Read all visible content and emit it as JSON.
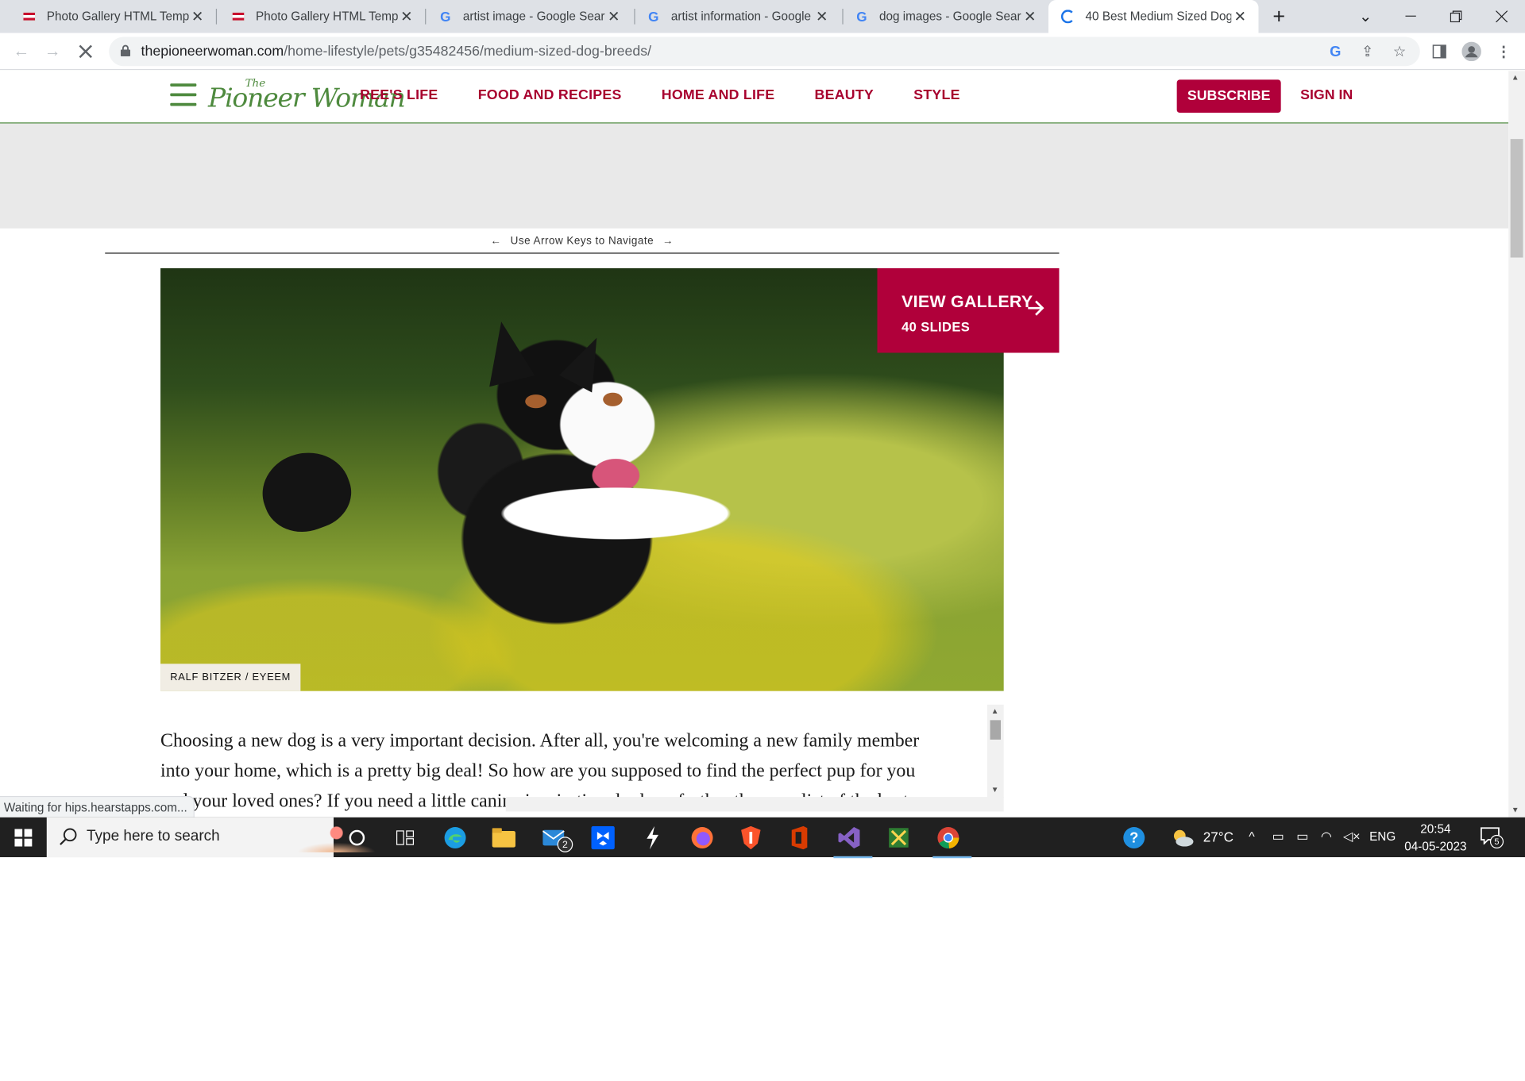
{
  "browser": {
    "tabs": [
      {
        "title": "Photo Gallery HTML Templa",
        "icon": "flag-favicon-icon"
      },
      {
        "title": "Photo Gallery HTML Templa",
        "icon": "flag-favicon-icon"
      },
      {
        "title": "artist image - Google Searc",
        "icon": "google-favicon-icon"
      },
      {
        "title": "artist information - Google",
        "icon": "google-favicon-icon"
      },
      {
        "title": "dog images - Google Searc",
        "icon": "google-favicon-icon"
      },
      {
        "title": "40 Best Medium Sized Dog",
        "icon": "loading-spinner-icon",
        "active": true
      }
    ],
    "new_tab_symbol": "+",
    "url_domain": "thepioneerwoman.com",
    "url_path": "/home-lifestyle/pets/g35482456/medium-sized-dog-breeds/",
    "status_text": "Waiting for hips.hearstapps.com..."
  },
  "site": {
    "logo_small": "The",
    "logo_main": "Pioneer Woman",
    "nav": [
      "REE'S LIFE",
      "FOOD AND RECIPES",
      "HOME AND LIFE",
      "BEAUTY",
      "STYLE"
    ],
    "subscribe_label": "SUBSCRIBE",
    "signin_label": "SIGN IN",
    "arrow_hint": "Use Arrow Keys to Navigate",
    "gallery_button": {
      "title": "VIEW GALLERY",
      "subtitle": "40 SLIDES"
    },
    "photo_credit": "RALF BITZER / EYEEM",
    "body_lines": [
      "Choosing a new dog is a very important decision. After all, you're welcoming a new family member",
      "into your home, which is a pretty big deal! So how are you supposed to find the perfect pup for you",
      "and your loved ones? If you need a little canine inspiration, look no further than our list of the best"
    ]
  },
  "taskbar": {
    "search_placeholder": "Type here to search",
    "mail_badge": "2",
    "temperature": "27°C",
    "language": "ENG",
    "time": "20:54",
    "date": "04-05-2023",
    "notification_count": "5"
  },
  "colors": {
    "brand_red": "#b0003a",
    "brand_green": "#4e8a3e"
  }
}
